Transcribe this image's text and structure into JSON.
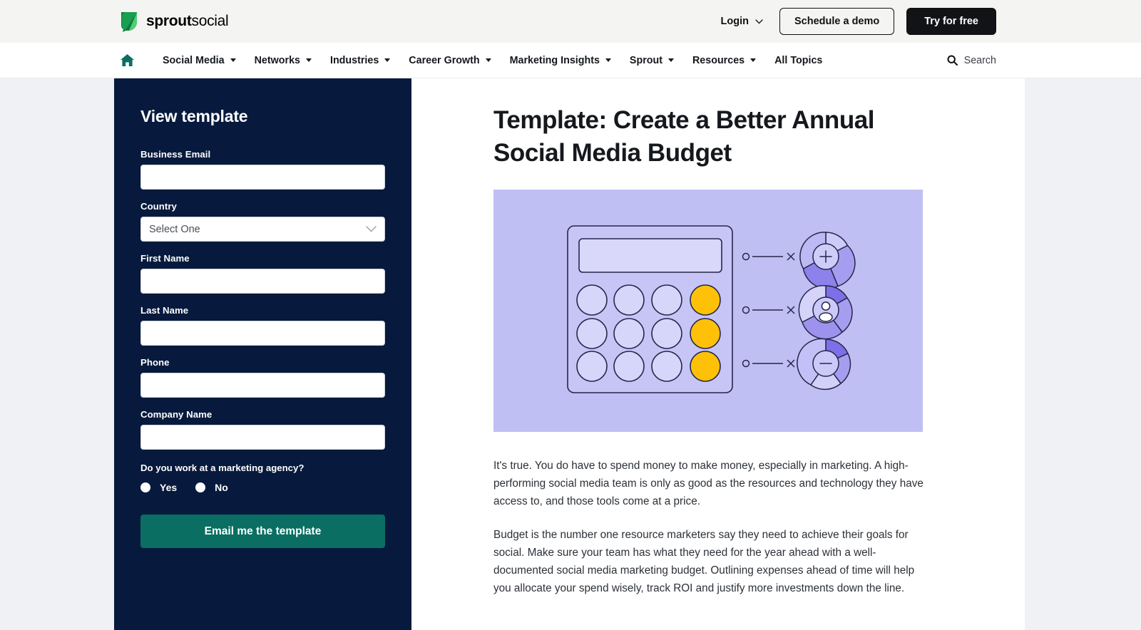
{
  "topbar": {
    "brand_bold": "sprout",
    "brand_light": "social",
    "logo_icon": "leaf-icon",
    "login_label": "Login",
    "login_chevron_icon": "chevron-down-icon",
    "demo_button": "Schedule a demo",
    "trial_button": "Try for free"
  },
  "nav": {
    "home_icon": "home-icon",
    "items": [
      {
        "label": "Social Media",
        "has_caret": true
      },
      {
        "label": "Networks",
        "has_caret": true
      },
      {
        "label": "Industries",
        "has_caret": true
      },
      {
        "label": "Career Growth",
        "has_caret": true
      },
      {
        "label": "Marketing Insights",
        "has_caret": true
      },
      {
        "label": "Sprout",
        "has_caret": true
      },
      {
        "label": "Resources",
        "has_caret": true
      },
      {
        "label": "All Topics",
        "has_caret": false
      }
    ],
    "search_icon": "search-icon",
    "search_label": "Search"
  },
  "form": {
    "title": "View template",
    "fields": [
      {
        "label": "Business Email",
        "type": "text",
        "value": "",
        "placeholder": ""
      },
      {
        "label": "Country",
        "type": "select",
        "value": "Select One"
      },
      {
        "label": "First Name",
        "type": "text",
        "value": "",
        "placeholder": ""
      },
      {
        "label": "Last Name",
        "type": "text",
        "value": "",
        "placeholder": ""
      },
      {
        "label": "Phone",
        "type": "text",
        "value": "",
        "placeholder": ""
      },
      {
        "label": "Company Name",
        "type": "text",
        "value": "",
        "placeholder": ""
      }
    ],
    "agency_question": "Do you work at a marketing agency?",
    "radio_yes": "Yes",
    "radio_no": "No",
    "submit_label": "Email me the template",
    "select_chevron_icon": "chevron-down-icon",
    "panel_color": "#071a3d",
    "submit_color": "#0a6e63"
  },
  "content": {
    "headline": "Template: Create a Better Annual Social Media Budget",
    "hero": {
      "alt_name": "calculator-and-donut-charts-illustration",
      "background_color": "#bfbff4",
      "accent_yellow": "#ffc107",
      "purple_dark": "#7d6fe8",
      "purple_mid": "#a79df0",
      "purple_light": "#ccc9f7",
      "center_icons": [
        "plus-icon",
        "person-icon",
        "minus-icon"
      ]
    },
    "paragraphs": [
      "It's true. You do have to spend money to make money, especially in marketing. A high-performing social media team is only as good as the resources and technology they have access to, and those tools come at a price.",
      "Budget is the number one resource marketers say they need to achieve their goals for social. Make sure your team has what they need for the year ahead with a well-documented social media marketing budget. Outlining expenses ahead of time will help you allocate your spend wisely, track ROI and justify more investments down the line."
    ]
  }
}
